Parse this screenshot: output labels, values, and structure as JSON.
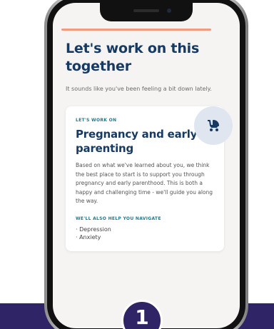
{
  "screen": {
    "title": "Let's work on this together",
    "subtitle": "It sounds like you've been feeling a bit down lately."
  },
  "card": {
    "eyebrow": "LET'S WORK ON",
    "title": "Pregnancy and early parenting",
    "icon": "stroller-icon",
    "body": "Based on what we've learned about you, we think the best place to start is to support you through pregnancy and early parenthood. This is both a happy and challenging time - we'll guide you along the way.",
    "section_label": "WE'LL ALSO HELP YOU NAVIGATE",
    "list": [
      "· Depression",
      "· Anxiety"
    ]
  },
  "step": {
    "number": "1"
  },
  "colors": {
    "accent": "#f19b83",
    "title": "#173a63",
    "teal": "#1f7a8c",
    "band": "#2e2466"
  }
}
